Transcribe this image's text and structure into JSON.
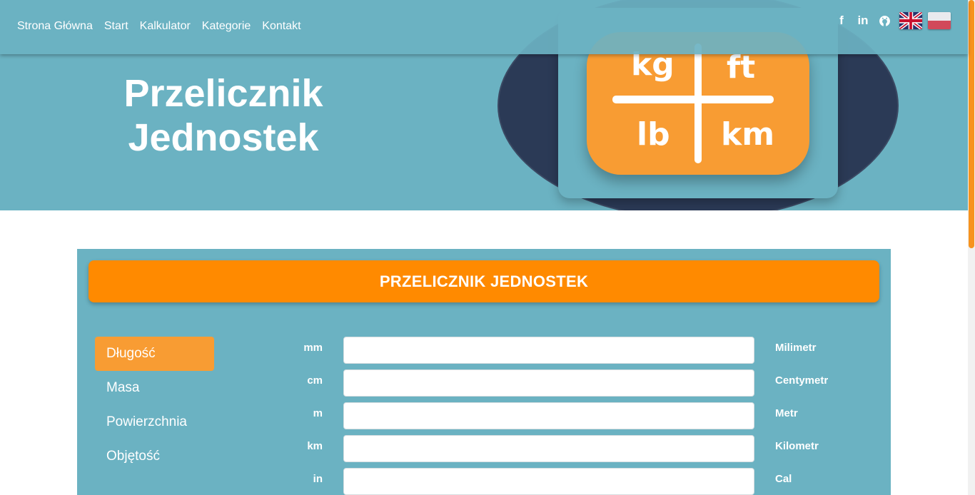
{
  "nav": {
    "links": [
      "Strona Główna",
      "Start",
      "Kalkulator",
      "Kategorie",
      "Kontakt"
    ],
    "social": {
      "facebook": "f",
      "linkedin": "in",
      "github": "github-icon"
    }
  },
  "hero": {
    "title_line1": "Przelicznik",
    "title_line2": "Jednostek",
    "logo_units": [
      "kg",
      "ft",
      "lb",
      "km"
    ]
  },
  "converter": {
    "header": "PRZELICZNIK JEDNOSTEK",
    "categories": [
      "Długość",
      "Masa",
      "Powierzchnia",
      "Objętość"
    ],
    "active_category": "Długość",
    "units": [
      {
        "symbol": "mm",
        "name": "Milimetr",
        "value": ""
      },
      {
        "symbol": "cm",
        "name": "Centymetr",
        "value": ""
      },
      {
        "symbol": "m",
        "name": "Metr",
        "value": ""
      },
      {
        "symbol": "km",
        "name": "Kilometr",
        "value": ""
      },
      {
        "symbol": "in",
        "name": "Cal",
        "value": ""
      }
    ]
  },
  "colors": {
    "teal": "#6bb2c2",
    "navy": "#2b3a56",
    "orange": "#ff8a00",
    "light_orange": "#f89c33"
  }
}
